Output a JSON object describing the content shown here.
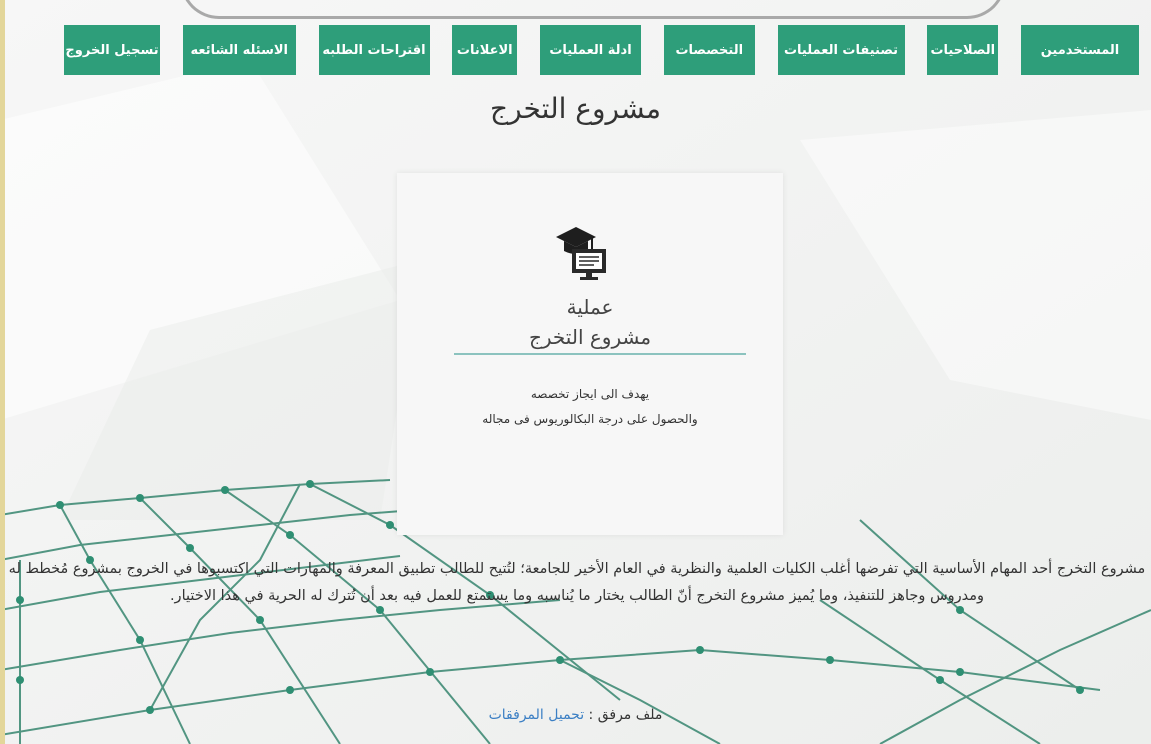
{
  "nav": {
    "items": [
      {
        "label": "المستخدمين",
        "width": 118
      },
      {
        "label": "الصلاحيات",
        "width": 71
      },
      {
        "label": "تصنيفات العمليات",
        "width": 127
      },
      {
        "label": "التخصصات",
        "width": 91
      },
      {
        "label": "ادلة العمليات",
        "width": 101
      },
      {
        "label": "الاعلانات",
        "width": 65
      },
      {
        "label": "اقتراحات الطلبه",
        "width": 111
      },
      {
        "label": "الاسئله الشائعه",
        "width": 113
      },
      {
        "label": "تسجيل الخروج",
        "width": 96
      }
    ]
  },
  "page_title": "مشروع التخرج",
  "card": {
    "icon": "graduation-cap-monitor-icon",
    "title_line1": "عملية",
    "title_line2": "مشروع التخرج",
    "desc_line1": "يهدف الى ايجاز تخصصه",
    "desc_line2": "والحصول على درجة البكالوريوس فى مجاله"
  },
  "body_text": "مشروع التخرج أحد المهام الأساسية التي تفرضها أغلب الكليات العلمية والنظرية في العام الأخير للجامعة؛ لتُتيح للطالب تطبيق المعرفة والمهارات التي اكتسبوها في الخروج بمشروع مُخطط له ومدروس وجاهز للتنفيذ، وما يُميز مشروع التخرج أنّ الطالب يختار ما يُناسبه وما يستمتع للعمل فيه بعد أن تُترك له الحرية في هذا الاختيار.",
  "attachment": {
    "label": "ملف مرفق :",
    "link_text": "تحميل المرفقات"
  },
  "colors": {
    "nav_bg": "#2e9e7a",
    "link": "#3b7fc4",
    "card_underline": "#8cc3bf"
  }
}
